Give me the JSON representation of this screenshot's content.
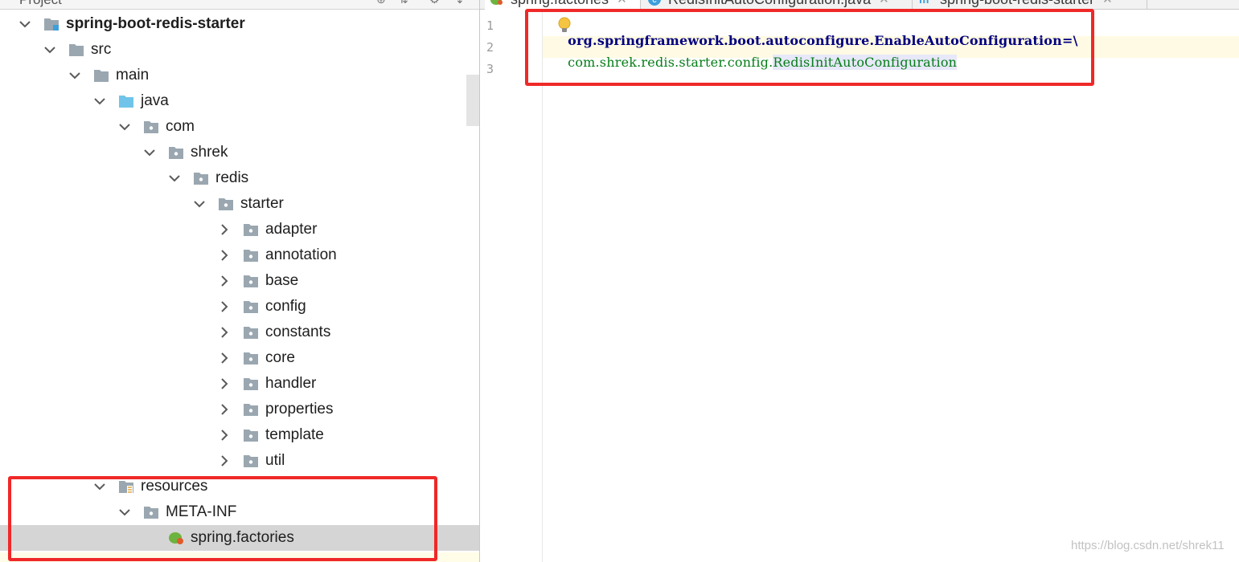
{
  "project_panel": {
    "title": "Project",
    "tree": [
      {
        "label": "spring-boot-redis-starter",
        "bold": true,
        "expanded": true,
        "icon": "module-folder-icon"
      },
      {
        "label": "src",
        "expanded": true,
        "icon": "folder-icon"
      },
      {
        "label": "main",
        "expanded": true,
        "icon": "folder-icon"
      },
      {
        "label": "java",
        "expanded": true,
        "icon": "source-root-folder-icon"
      },
      {
        "label": "com",
        "expanded": true,
        "icon": "package-icon"
      },
      {
        "label": "shrek",
        "expanded": true,
        "icon": "package-icon"
      },
      {
        "label": "redis",
        "expanded": true,
        "icon": "package-icon"
      },
      {
        "label": "starter",
        "expanded": true,
        "icon": "package-icon"
      },
      {
        "label": "adapter",
        "expanded": false,
        "icon": "package-icon"
      },
      {
        "label": "annotation",
        "expanded": false,
        "icon": "package-icon"
      },
      {
        "label": "base",
        "expanded": false,
        "icon": "package-icon"
      },
      {
        "label": "config",
        "expanded": false,
        "icon": "package-icon"
      },
      {
        "label": "constants",
        "expanded": false,
        "icon": "package-icon"
      },
      {
        "label": "core",
        "expanded": false,
        "icon": "package-icon"
      },
      {
        "label": "handler",
        "expanded": false,
        "icon": "package-icon"
      },
      {
        "label": "properties",
        "expanded": false,
        "icon": "package-icon"
      },
      {
        "label": "template",
        "expanded": false,
        "icon": "package-icon"
      },
      {
        "label": "util",
        "expanded": false,
        "icon": "package-icon"
      },
      {
        "label": "resources",
        "expanded": true,
        "icon": "resources-folder-icon"
      },
      {
        "label": "META-INF",
        "expanded": true,
        "icon": "package-icon"
      },
      {
        "label": "spring.factories",
        "selected": true,
        "icon": "spring-file-icon"
      }
    ]
  },
  "editor": {
    "tabs": [
      {
        "label": "spring.factories",
        "active": true,
        "icon": "spring-file-icon"
      },
      {
        "label": "RedisInitAutoConfiguration.java",
        "active": false,
        "icon": "java-class-icon"
      },
      {
        "label": "spring-boot-redis-starter",
        "active": false,
        "icon": "maven-icon"
      }
    ],
    "line_numbers": [
      "1",
      "2",
      "3"
    ],
    "lines": [
      {
        "key": "org.springframework.boot.autoconfigure.EnableAutoConfiguration=\\"
      },
      {
        "prefix": "com.shrek.redis.starter.config.",
        "highlight": "RedisInitAutoConfiguration"
      },
      {
        "text": ""
      }
    ]
  },
  "annotation_color": "#f02828",
  "watermark": "https://blog.csdn.net/shrek11"
}
